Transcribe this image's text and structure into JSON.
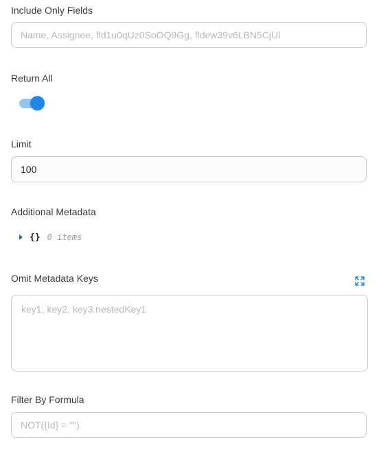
{
  "include_fields": {
    "label": "Include Only Fields",
    "placeholder": "Name, Assignee, fld1u0qUz0SoOQ9Gg, fldew39v6LBN5CjUl",
    "value": ""
  },
  "return_all": {
    "label": "Return All",
    "enabled": true
  },
  "limit": {
    "label": "Limit",
    "value": "100"
  },
  "additional_metadata": {
    "label": "Additional Metadata",
    "braces": "{}",
    "items_text": "0 items"
  },
  "omit_keys": {
    "label": "Omit Metadata Keys",
    "placeholder": "key1, key2, key3.nestedKey1",
    "value": "",
    "expand_icon": "expand-icon"
  },
  "filter_formula": {
    "label": "Filter By Formula",
    "placeholder": "NOT({Id} = \"\")",
    "value": ""
  },
  "colors": {
    "accent": "#1e88e5",
    "accent_light": "#8ec5f4",
    "border": "#c9c9c9"
  }
}
